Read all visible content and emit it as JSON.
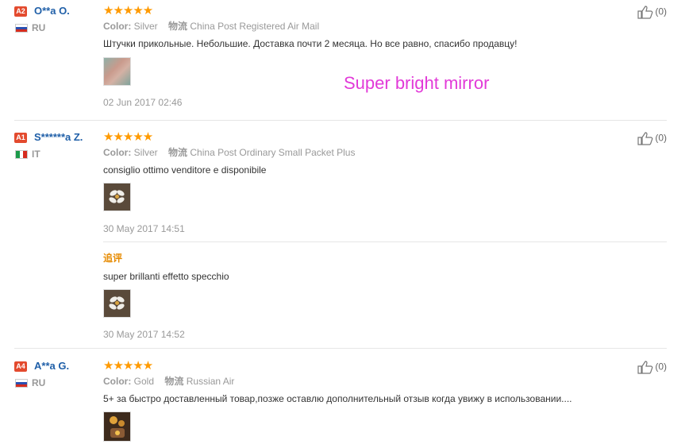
{
  "overlay_text": "Super bright mirror",
  "reviews": [
    {
      "level": "A2",
      "name": "O**a O.",
      "country": "RU",
      "stars": "★★★★★",
      "color_label": "Color:",
      "color_value": "Silver",
      "shipping_label": "物流",
      "shipping_value": "China Post Registered Air Mail",
      "text": "Штучки прикольные. Небольшие. Доставка почти 2 месяца. Но все равно, спасибо продавцу!",
      "date": "02 Jun 2017 02:46",
      "helpful": "(0)"
    },
    {
      "level": "A1",
      "name": "S******a Z.",
      "country": "IT",
      "stars": "★★★★★",
      "color_label": "Color:",
      "color_value": "Silver",
      "shipping_label": "物流",
      "shipping_value": "China Post Ordinary Small Packet Plus",
      "text": "consiglio ottimo venditore e disponibile",
      "date": "30 May 2017 14:51",
      "helpful": "(0)",
      "followup_label": "追评",
      "followup_text": "super brillanti effetto specchio",
      "followup_date": "30 May 2017 14:52"
    },
    {
      "level": "A4",
      "name": "A**a G.",
      "country": "RU",
      "stars": "★★★★★",
      "color_label": "Color:",
      "color_value": "Gold",
      "shipping_label": "物流",
      "shipping_value": "Russian Air",
      "text": "5+ за быстро доставленный товар,позже оставлю дополнительный отзыв когда увижу в использовании....",
      "helpful": "(0)"
    }
  ]
}
